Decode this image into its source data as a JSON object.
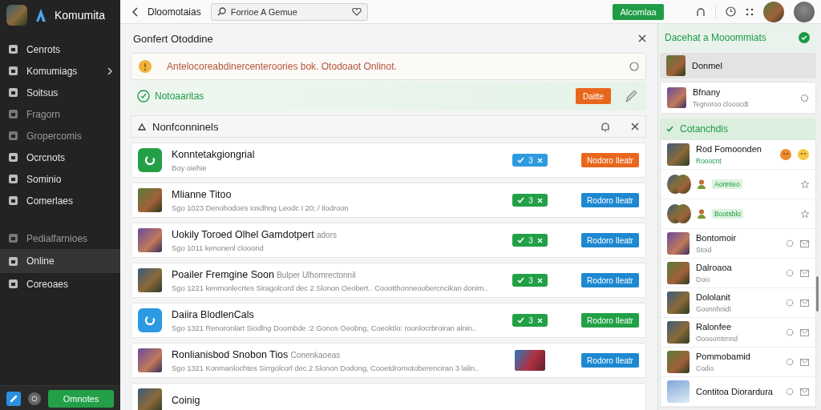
{
  "sidebar": {
    "brand": "Komumita",
    "groups": [
      {
        "items": [
          {
            "label": "Cenrots",
            "selected": false,
            "disabled": false,
            "expandable": false
          },
          {
            "label": "Komumiags",
            "selected": false,
            "disabled": false,
            "expandable": true
          },
          {
            "label": "Soitsus",
            "selected": false,
            "disabled": false,
            "expandable": false
          },
          {
            "label": "Fragorn",
            "selected": false,
            "disabled": true,
            "expandable": false
          },
          {
            "label": "Gropercomis",
            "selected": false,
            "disabled": true,
            "expandable": false
          },
          {
            "label": "Ocrcnots",
            "selected": false,
            "disabled": false,
            "expandable": false
          },
          {
            "label": "Sominio",
            "selected": false,
            "disabled": false,
            "expandable": false
          },
          {
            "label": "Comerlaes",
            "selected": false,
            "disabled": false,
            "expandable": false
          }
        ]
      },
      {
        "items": [
          {
            "label": "Pedialfarnioes",
            "selected": false,
            "disabled": true,
            "expandable": false
          },
          {
            "label": "Online",
            "selected": true,
            "disabled": false,
            "expandable": false
          },
          {
            "label": "Coreoaes",
            "selected": false,
            "disabled": false,
            "expandable": false
          }
        ]
      }
    ],
    "footer_button": "Omnotes"
  },
  "topbar": {
    "title": "Dloomotaias",
    "search": {
      "value": "Forrioe A Gemue"
    },
    "button": "Alcomlaa"
  },
  "panel": {
    "title": "Gonfert Otoddine",
    "alert": "Antelocoreabdinercenteroories bok. Otodoaot Onlinot.",
    "success": {
      "label": "Notoaaritas",
      "button": "Daitte"
    },
    "section": {
      "title": "Nonfconninels",
      "rows": [
        {
          "title": "Konntetakgiongrial",
          "subtitle": "Boy oiehie",
          "avatar": {
            "kind": "app",
            "color": "#23a047"
          },
          "badge": {
            "kind": "count",
            "text": "3",
            "color": "#2d9be0"
          },
          "button": {
            "label": "Nodoro Ileatr",
            "color": "#e8671d"
          }
        },
        {
          "title": "Mlianne Titoo",
          "subtitle": "Sgo 1023 Denohodoes Iosdhng Leodc I 20; / Ilodroon",
          "avatar": {
            "kind": "photo"
          },
          "badge": {
            "kind": "count",
            "text": "3",
            "color": "#21a046"
          },
          "button": {
            "label": "Rodoro Ileatr",
            "color": "#1e88d0"
          }
        },
        {
          "title": "Uokily Toroed Olhel Gamdotpert",
          "note": "adors",
          "subtitle": "Sgo 1011 kenonenl clooond",
          "avatar": {
            "kind": "photo"
          },
          "badge": {
            "kind": "count",
            "text": "3",
            "color": "#21a046"
          },
          "button": {
            "label": "Rodoro Ileatr",
            "color": "#1e88d0"
          }
        },
        {
          "title": "Poailer Fremgine Soon",
          "note": "Bulper Ulhomrectonnil",
          "subtitle": "Sgo 1221 kenmonlecrtes Siragolcord dec 2 Slonon Oeobert.. Coootthonneoobercncikan donim..",
          "avatar": {
            "kind": "photo"
          },
          "badge": {
            "kind": "count",
            "text": "3",
            "color": "#21a046"
          },
          "button": {
            "label": "Rodoro Ileatr",
            "color": "#1e88d0"
          }
        },
        {
          "title": "Daiira BlodlenCals",
          "subtitle": "Sgo 1321 Renoronlart Siodlng Doombde :2 Gonos Oeobng, Coeoktlo: roonlocrbroiran alnin..",
          "avatar": {
            "kind": "app",
            "color": "#2c9ae2"
          },
          "badge": {
            "kind": "count",
            "text": "3",
            "color": "#21a046"
          },
          "button": {
            "label": "Rodoro Ileatr",
            "color": "#21a046"
          }
        },
        {
          "title": "Ronlianisbod Snobon Tios",
          "note": "Conenkaoeas",
          "subtitle": "Sgo 1321 Konmanlochtes Sirrgolcorl dec 2 Slonon Dodong, Cooetdrornotoberenciran 3 lalin..",
          "avatar": {
            "kind": "photo"
          },
          "badge": {
            "kind": "image"
          },
          "button": {
            "label": "Rodoro Ileatr",
            "color": "#1e88d0"
          }
        },
        {
          "title": "Coinig",
          "avatar": {
            "kind": "photo"
          }
        }
      ]
    }
  },
  "right": {
    "title": "Dacehat a Mooommiats",
    "items": [
      {
        "name": "Donmel",
        "selected": true
      },
      {
        "name": "Bfnany",
        "subtitle": "Tegnoroo clooocdt",
        "selected": false
      }
    ],
    "section": {
      "title": "Cotanchdis",
      "contacts": [
        {
          "kind": "reaction",
          "name": "Rod Fomoonden",
          "status": "Rooocnt"
        },
        {
          "kind": "group",
          "tag": "Aonnteo"
        },
        {
          "kind": "group",
          "tag": "Bootsblo"
        },
        {
          "kind": "contact",
          "name": "Bontomoir",
          "status": "Stoid"
        },
        {
          "kind": "contact",
          "name": "Dalroaoa",
          "status": "Doio"
        },
        {
          "kind": "contact",
          "name": "Dololanit",
          "status": "Goonnhnidt"
        },
        {
          "kind": "contact",
          "name": "Ralonfee",
          "status": "Ooooomtrnnd"
        },
        {
          "kind": "contact",
          "name": "Pommobamid",
          "status": "Codio"
        },
        {
          "kind": "contact",
          "name": "Contitoa Diorardura"
        }
      ]
    }
  }
}
